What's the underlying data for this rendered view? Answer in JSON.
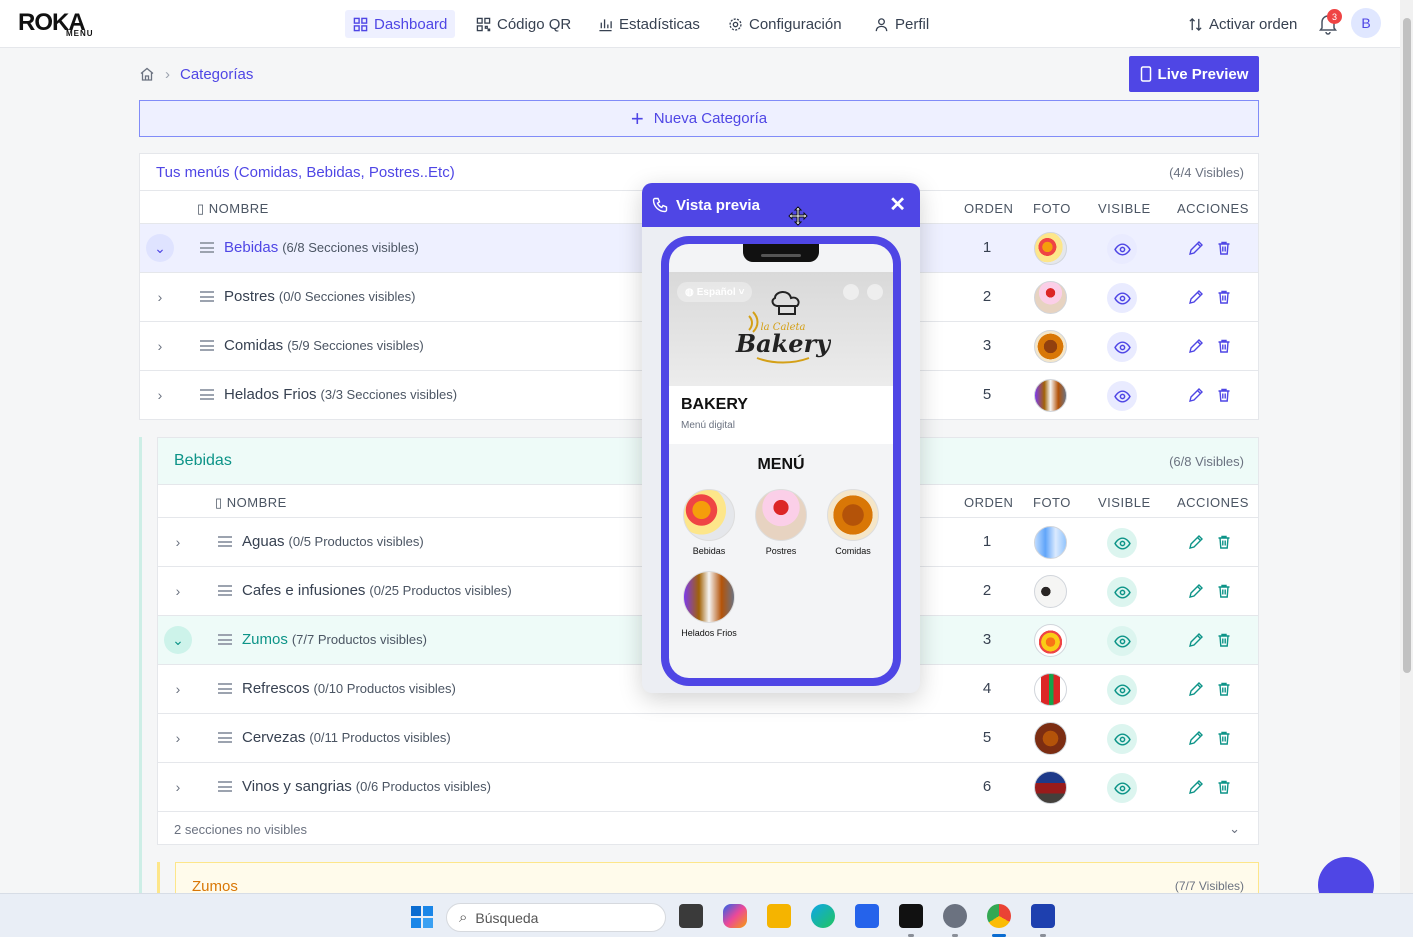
{
  "brand": {
    "name": "ROKA",
    "sub": "MENU"
  },
  "nav": [
    {
      "label": "Dashboard",
      "icon": "grid-icon"
    },
    {
      "label": "Código QR",
      "icon": "qr-icon"
    },
    {
      "label": "Estadísticas",
      "icon": "chart-icon"
    },
    {
      "label": "Configuración",
      "icon": "gear-icon"
    },
    {
      "label": "Perfil",
      "icon": "user-icon"
    }
  ],
  "header": {
    "activar": "Activar orden",
    "notif_count": "3",
    "avatar": "B"
  },
  "breadcrumb": {
    "current": "Categorías"
  },
  "live_preview": "Live Preview",
  "nueva_categoria": "Nueva Categoría",
  "menus_card": {
    "title": "Tus menús (Comidas, Bebidas, Postres..Etc)",
    "count": "(4/4 Visibles)",
    "columns": {
      "nombre": "NOMBRE",
      "orden": "ORDEN",
      "foto": "FOTO",
      "visible": "VISIBLE",
      "acciones": "ACCIONES"
    },
    "rows": [
      {
        "name": "Bebidas",
        "sub": "(6/8 Secciones visibles)",
        "orden": "1"
      },
      {
        "name": "Postres",
        "sub": "(0/0 Secciones visibles)",
        "orden": "2"
      },
      {
        "name": "Comidas",
        "sub": "(5/9 Secciones visibles)",
        "orden": "3"
      },
      {
        "name": "Helados Frios",
        "sub": "(3/3 Secciones visibles)",
        "orden": "5"
      }
    ]
  },
  "bebidas_card": {
    "title": "Bebidas",
    "count": "(6/8 Visibles)",
    "columns": {
      "nombre": "NOMBRE",
      "orden": "ORDEN",
      "foto": "FOTO",
      "visible": "VISIBLE",
      "acciones": "ACCIONES"
    },
    "rows": [
      {
        "name": "Aguas",
        "sub": "(0/5 Productos visibles)",
        "orden": "1"
      },
      {
        "name": "Cafes e infusiones",
        "sub": "(0/25 Productos visibles)",
        "orden": "2"
      },
      {
        "name": "Zumos",
        "sub": "(7/7 Productos visibles)",
        "orden": "3"
      },
      {
        "name": "Refrescos",
        "sub": "(0/10 Productos visibles)",
        "orden": "4"
      },
      {
        "name": "Cervezas",
        "sub": "(0/11 Productos visibles)",
        "orden": "5"
      },
      {
        "name": "Vinos y sangrias",
        "sub": "(0/6 Productos visibles)",
        "orden": "6"
      }
    ],
    "footer": "2 secciones no visibles"
  },
  "zumos_card": {
    "title": "Zumos",
    "count": "(7/7 Visibles)"
  },
  "preview": {
    "title": "Vista previa",
    "language": "Español",
    "business": "BAKERY",
    "subtitle": "Menú digital",
    "menu_title": "MENÚ",
    "logo_text": "La Caleta Bakery",
    "categories": [
      {
        "label": "Bebidas"
      },
      {
        "label": "Postres"
      },
      {
        "label": "Comidas"
      },
      {
        "label": "Helados Frios"
      }
    ]
  },
  "taskbar": {
    "search": "Búsqueda"
  },
  "colors": {
    "accent": "#4f46e5",
    "teal": "#0d9488",
    "amber": "#d97706"
  }
}
